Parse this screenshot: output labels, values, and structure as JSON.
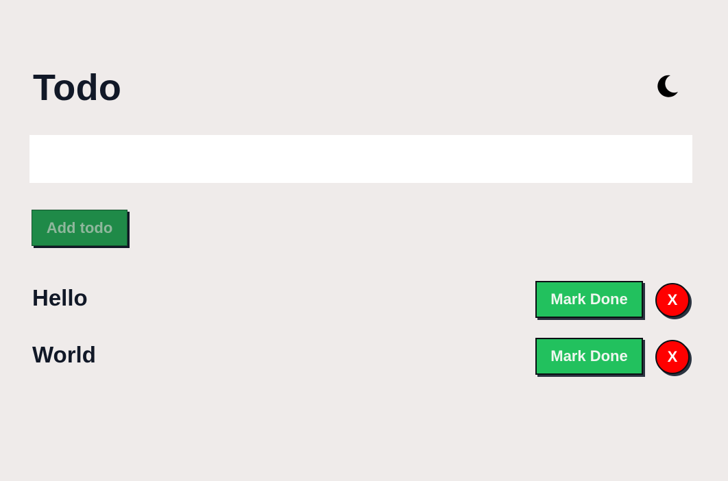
{
  "app": {
    "title": "Todo",
    "theme_toggle_icon": "moon-icon"
  },
  "input": {
    "value": "",
    "placeholder": ""
  },
  "add_button": {
    "label": "Add todo"
  },
  "todos": [
    {
      "text": "Hello",
      "done_label": "Mark Done",
      "delete_label": "X"
    },
    {
      "text": "World",
      "done_label": "Mark Done",
      "delete_label": "X"
    }
  ],
  "colors": {
    "background": "#efebea",
    "add_button": "#1f8a48",
    "done_button": "#22c15e",
    "delete_button": "#ff0000",
    "text": "#111827"
  }
}
